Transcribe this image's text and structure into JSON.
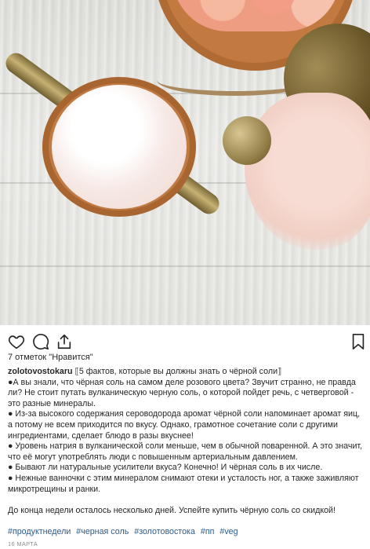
{
  "post": {
    "likes_text": "7 отметок \"Нравится\"",
    "username": "zolotovostokaru",
    "caption_title": "5 фактов, которые вы должны знать о чёрной соли",
    "paragraphs": [
      "●А вы знали, что чёрная соль на самом деле розового цвета? Звучит странно, не правда ли? Не стоит путать вулканическую черную соль, о которой пойдет речь, с четверговой - это разные минералы.",
      "● Из-за высокого содержания сероводорода аромат чёрной соли напоминает аромат яиц, а потому не всем приходится по вкусу. Однако, грамотное сочетание соли с другими ингредиентами, сделает блюдо в разы вкуснее!",
      "● Уровень натрия в вулканической соли меньше, чем в обычной поваренной. А это значит, что её могут употреблять люди с повышенным артериальным давлением.",
      "● Бывают ли натуральные усилители вкуса? Конечно! И чёрная соль в их числе.",
      "● Нежные ванночки с этим минералом снимают отеки и усталость ног, а также заживляют микротрещины и ранки."
    ],
    "closing": "До конца недели осталось несколько дней. Успейте купить чёрную соль со скидкой!",
    "hashtags": [
      "#продуктнедели",
      "#черная соль",
      "#золотовостока",
      "#пп",
      "#veg"
    ],
    "date": "16 МАРТА"
  },
  "icons": {
    "like": "heart-icon",
    "comment": "comment-bubble-icon",
    "share": "share-icon",
    "save": "bookmark-icon"
  }
}
